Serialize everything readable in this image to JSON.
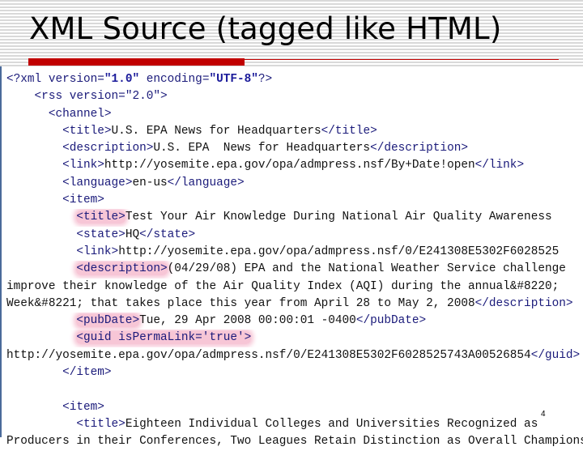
{
  "slide": {
    "title": "XML Source (tagged like HTML)",
    "page_number": "4",
    "accent_color": "#c00000",
    "highlight_color": "#f7c6d6"
  },
  "code": {
    "lines": [
      {
        "indent": "",
        "parts": [
          {
            "t": "<?xml version=",
            "c": "tag"
          },
          {
            "t": "\"1.0\"",
            "c": "attrval"
          },
          {
            "t": " encoding=",
            "c": "tag"
          },
          {
            "t": "\"UTF-8\"",
            "c": "attrval"
          },
          {
            "t": "?>",
            "c": "tag"
          }
        ]
      },
      {
        "indent": "    ",
        "parts": [
          {
            "t": "<rss version=",
            "c": "tag"
          },
          {
            "t": "\"2.0\"",
            "c": "tag"
          },
          {
            "t": ">",
            "c": "tag"
          }
        ]
      },
      {
        "indent": "      ",
        "parts": [
          {
            "t": "<channel>",
            "c": "tag"
          }
        ]
      },
      {
        "indent": "        ",
        "parts": [
          {
            "t": "<title>",
            "c": "tag"
          },
          {
            "t": "U.S. EPA News for Headquarters",
            "c": "txt"
          },
          {
            "t": "</title>",
            "c": "tag"
          }
        ]
      },
      {
        "indent": "        ",
        "parts": [
          {
            "t": "<description>",
            "c": "tag"
          },
          {
            "t": "U.S. EPA  News for Headquarters",
            "c": "txt"
          },
          {
            "t": "</description>",
            "c": "tag"
          }
        ]
      },
      {
        "indent": "        ",
        "parts": [
          {
            "t": "<link>",
            "c": "tag"
          },
          {
            "t": "http://yosemite.epa.gov/opa/admpress.nsf/By+Date!open",
            "c": "txt"
          },
          {
            "t": "</link>",
            "c": "tag"
          }
        ]
      },
      {
        "indent": "        ",
        "parts": [
          {
            "t": "<language>",
            "c": "tag"
          },
          {
            "t": "en-us",
            "c": "txt"
          },
          {
            "t": "</language>",
            "c": "tag"
          }
        ]
      },
      {
        "indent": "        ",
        "parts": [
          {
            "t": "<item>",
            "c": "tag"
          }
        ]
      },
      {
        "indent": "          ",
        "parts": [
          {
            "t": "<title>",
            "c": "hl"
          },
          {
            "t": "Test Your Air Knowledge During National Air Quality Awareness",
            "c": "txt"
          }
        ]
      },
      {
        "indent": "          ",
        "parts": [
          {
            "t": "<state>",
            "c": "tag"
          },
          {
            "t": "HQ",
            "c": "txt"
          },
          {
            "t": "</state>",
            "c": "tag"
          }
        ]
      },
      {
        "indent": "          ",
        "parts": [
          {
            "t": "<link>",
            "c": "tag"
          },
          {
            "t": "http://yosemite.epa.gov/opa/admpress.nsf/0/E241308E5302F6028525",
            "c": "txt"
          }
        ]
      },
      {
        "indent": "          ",
        "parts": [
          {
            "t": "<description>",
            "c": "hl"
          },
          {
            "t": "(04/29/08) EPA and the National Weather Service challenge",
            "c": "txt"
          }
        ]
      },
      {
        "indent": "",
        "parts": [
          {
            "t": "improve their knowledge of the Air Quality Index (AQI) during the annual&#8220;",
            "c": "txt"
          }
        ]
      },
      {
        "indent": "",
        "parts": [
          {
            "t": "Week&#8221; that takes place this year from April 28 to May 2, 2008",
            "c": "txt"
          },
          {
            "t": "</description>",
            "c": "tag"
          }
        ]
      },
      {
        "indent": "          ",
        "parts": [
          {
            "t": "<pubDate>",
            "c": "hl"
          },
          {
            "t": "Tue, 29 Apr 2008 00:00:01 -0400",
            "c": "txt"
          },
          {
            "t": "</pubDate>",
            "c": "tag"
          }
        ]
      },
      {
        "indent": "          ",
        "parts": [
          {
            "t": "<guid isPermaLink='true'>",
            "c": "hl"
          }
        ]
      },
      {
        "indent": "",
        "parts": [
          {
            "t": "http://yosemite.epa.gov/opa/admpress.nsf/0/E241308E5302F6028525743A00526854",
            "c": "txt"
          },
          {
            "t": "</guid>",
            "c": "tag"
          }
        ]
      },
      {
        "indent": "        ",
        "parts": [
          {
            "t": "</item>",
            "c": "tag"
          }
        ]
      },
      {
        "indent": "",
        "parts": []
      },
      {
        "indent": "        ",
        "parts": [
          {
            "t": "<item>",
            "c": "tag"
          }
        ]
      },
      {
        "indent": "          ",
        "parts": [
          {
            "t": "<title>",
            "c": "tag"
          },
          {
            "t": "Eighteen Individual Colleges and Universities Recognized as",
            "c": "txt"
          }
        ]
      },
      {
        "indent": "",
        "parts": [
          {
            "t": "Producers in their Conferences, Two Leagues Retain Distinction as Overall Champions",
            "c": "txt"
          }
        ]
      }
    ]
  }
}
